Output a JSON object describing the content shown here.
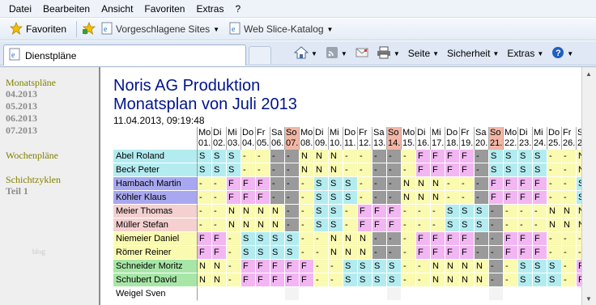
{
  "menu": [
    "Datei",
    "Bearbeiten",
    "Ansicht",
    "Favoriten",
    "Extras",
    "?"
  ],
  "favbar": {
    "favorites": "Favoriten",
    "suggested": "Vorgeschlagene Sites",
    "webslice": "Web Slice-Katalog"
  },
  "tab": {
    "label": "Dienstpläne"
  },
  "commands": {
    "page": "Seite",
    "security": "Sicherheit",
    "tools": "Extras"
  },
  "sidebar": {
    "monthly_heading": "Monatspläne",
    "months": [
      "04.2013",
      "05.2013",
      "06.2013",
      "07.2013"
    ],
    "weekly_heading": "Wochenpläne",
    "cycles_heading": "Schichtzyklen",
    "cycles": [
      "Teil 1"
    ],
    "blog": "blog"
  },
  "page": {
    "title": "Noris AG Produktion",
    "subtitle": "Monatsplan von Juli 2013",
    "timestamp": "11.04.2013, 09:19:48"
  },
  "schedule": {
    "days": [
      {
        "wd": "Mo",
        "d": "01."
      },
      {
        "wd": "Di",
        "d": "02."
      },
      {
        "wd": "Mi",
        "d": "03."
      },
      {
        "wd": "Do",
        "d": "04."
      },
      {
        "wd": "Fr",
        "d": "05."
      },
      {
        "wd": "Sa",
        "d": "06."
      },
      {
        "wd": "So",
        "d": "07."
      },
      {
        "wd": "Mo",
        "d": "08."
      },
      {
        "wd": "Di",
        "d": "09."
      },
      {
        "wd": "Mi",
        "d": "10."
      },
      {
        "wd": "Do",
        "d": "11."
      },
      {
        "wd": "Fr",
        "d": "12."
      },
      {
        "wd": "Sa",
        "d": "13."
      },
      {
        "wd": "So",
        "d": "14."
      },
      {
        "wd": "Mo",
        "d": "15."
      },
      {
        "wd": "Di",
        "d": "16."
      },
      {
        "wd": "Mi",
        "d": "17."
      },
      {
        "wd": "Do",
        "d": "18."
      },
      {
        "wd": "Fr",
        "d": "19."
      },
      {
        "wd": "Sa",
        "d": "20."
      },
      {
        "wd": "So",
        "d": "21."
      },
      {
        "wd": "Mo",
        "d": "22."
      },
      {
        "wd": "Di",
        "d": "23."
      },
      {
        "wd": "Mi",
        "d": "24."
      },
      {
        "wd": "Do",
        "d": "25."
      },
      {
        "wd": "Fr",
        "d": "26."
      },
      {
        "wd": "S",
        "d": "2"
      }
    ],
    "rows": [
      {
        "name": "Abel Roland",
        "color": "#b3ecf0",
        "cells": "SSS----NNN-----FFFF-SSSS--NNN"
      },
      {
        "name": "Beck Peter",
        "color": "#b3ecf0",
        "cells": "SSS----NNN-----FFFF-SSSS--NNN"
      },
      {
        "name": "Hambach Martin",
        "color": "#a8a8f0",
        "cells": "--FFF---SSS---NNN---FFFF--SSS"
      },
      {
        "name": "Köhler Klaus",
        "color": "#a8a8f0",
        "cells": "--FFF---SSS---NNN---FFFF--SSS"
      },
      {
        "name": "Meier Thomas",
        "color": "#f5d0d0",
        "cells": "--NNNN--SS-FFF---SSS----NNN--F"
      },
      {
        "name": "Müller Stefan",
        "color": "#f5d0d0",
        "cells": "--NNNN--SS-FFF---SSS----NNN--F"
      },
      {
        "name": "Niemeier Daniel",
        "color": "#fafab0",
        "cells": "FF-SSSS--NNN---FFFF--FFF---SS"
      },
      {
        "name": "Römer Reiner",
        "color": "#fafab0",
        "cells": "FF-SSSS--NNN---FFFF--FFF---SS"
      },
      {
        "name": "Schneider Moritz",
        "color": "#a8e6a8",
        "cells": "NN-FFFFF--SSSS--NNNN--SSS-FFF"
      },
      {
        "name": "Schubert David",
        "color": "#a8e6a8",
        "cells": "NN-FFFFF--SSSS--NNNN--SSS-FFF"
      },
      {
        "name": "Weigel Sven",
        "color": "#ffffff",
        "cells": ""
      }
    ]
  }
}
